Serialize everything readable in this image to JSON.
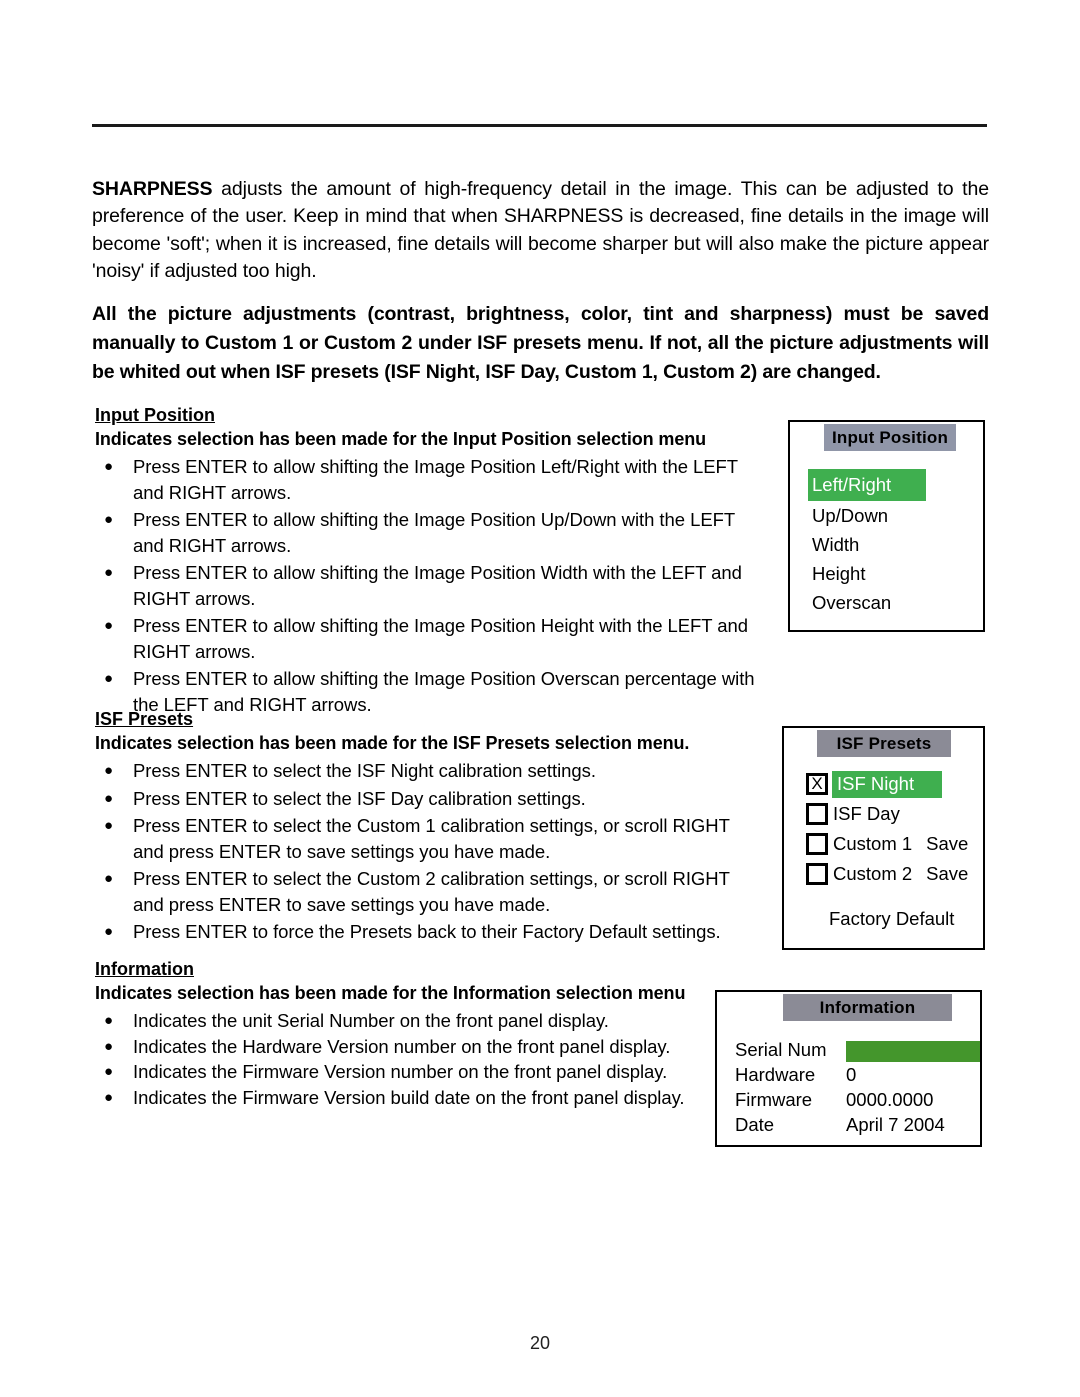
{
  "page": {
    "number": "20"
  },
  "intro": {
    "lead": "SHARPNESS",
    "text": " adjusts the amount of high-frequency detail in the image. This can be adjusted to the preference of the user. Keep in mind that when SHARPNESS is decreased, fine details in the image will become 'soft'; when it is increased, fine details will become sharper but will also make the picture appear 'noisy' if adjusted too high."
  },
  "notice": {
    "text": "All the picture adjustments (contrast, brightness, color, tint and sharpness) must be saved manually to Custom 1 or Custom 2 under ISF presets menu. If not, all the picture adjustments will be whited out when ISF presets (ISF Night, ISF Day, Custom 1, Custom 2) are changed."
  },
  "sections": [
    {
      "title": "Input Position",
      "subtitle": "Indicates selection has been made for the Input Position selection menu",
      "bullets": [
        "Press ENTER to allow shifting the Image Position Left/Right with the LEFT and RIGHT arrows.",
        "Press ENTER to allow shifting the Image Position Up/Down with the LEFT and RIGHT arrows.",
        "Press ENTER to allow shifting the Image Position Width with the LEFT and RIGHT arrows.",
        "Press ENTER to allow shifting the Image Position Height with the LEFT and RIGHT arrows.",
        "Press ENTER to allow shifting the Image Position Overscan percentage with the LEFT and RIGHT arrows."
      ]
    },
    {
      "title": "ISF Presets",
      "subtitle": "Indicates selection has been made for the ISF Presets selection menu.",
      "bullets": [
        "Press ENTER to select the ISF Night calibration settings.",
        "Press ENTER to select the ISF Day calibration settings.",
        "Press ENTER to select the Custom 1 calibration settings, or scroll RIGHT and press ENTER to save settings you have made.",
        "Press ENTER to select the Custom 2 calibration settings, or scroll RIGHT and press ENTER to save settings you have made.",
        "Press ENTER to force the Presets back to their Factory Default settings."
      ]
    },
    {
      "title": "Information",
      "subtitle": "Indicates selection has been made for the Information selection menu",
      "bullets": [
        "Indicates the unit Serial Number on the front panel display.",
        "Indicates the Hardware Version number on the front panel display.",
        "Indicates the Firmware Version number on the front panel display.",
        "Indicates the Firmware Version build date on the front panel display."
      ]
    }
  ],
  "osd_menus": {
    "input_position": {
      "title": "Input Position",
      "header_color": "#9096a8",
      "highlight_color": "#3faf4f",
      "items": [
        {
          "label": "Left/Right",
          "selected": true
        },
        {
          "label": "Up/Down",
          "selected": false
        },
        {
          "label": "Width",
          "selected": false
        },
        {
          "label": "Height",
          "selected": false
        },
        {
          "label": "Overscan",
          "selected": false
        }
      ]
    },
    "isf_presets": {
      "title": "ISF Presets",
      "header_color": "#8b8b96",
      "highlight_color": "#3faf4f",
      "items": [
        {
          "label": "ISF Night",
          "checkbox": "X",
          "selected": true,
          "action": ""
        },
        {
          "label": "ISF Day",
          "checkbox": "",
          "selected": false,
          "action": ""
        },
        {
          "label": "Custom 1",
          "checkbox": "",
          "selected": false,
          "action": "Save"
        },
        {
          "label": "Custom 2",
          "checkbox": "",
          "selected": false,
          "action": "Save"
        }
      ],
      "factory_default_label": "Factory Default"
    },
    "information": {
      "title": "Information",
      "header_color": "#8b8b96",
      "bar_color": "#44962c",
      "rows": [
        {
          "key": "Serial Num",
          "value": "",
          "bar": true
        },
        {
          "key": "Hardware",
          "value": "0",
          "bar": false
        },
        {
          "key": "Firmware",
          "value": "0000.0000",
          "bar": false
        },
        {
          "key": "Date",
          "value": "April  7  2004",
          "bar": false
        }
      ]
    }
  }
}
